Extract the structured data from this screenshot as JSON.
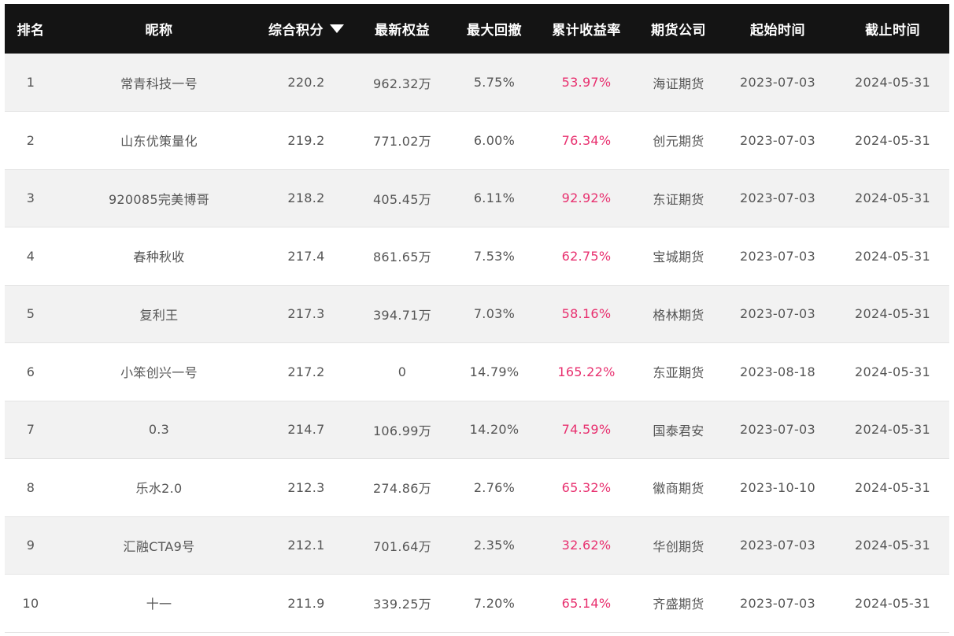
{
  "headers": {
    "rank": "排名",
    "nickname": "昵称",
    "score": "综合积分",
    "equity": "最新权益",
    "drawdown": "最大回撤",
    "return": "累计收益率",
    "company": "期货公司",
    "start": "起始时间",
    "end": "截止时间"
  },
  "icons": {
    "sort": "sort-desc-icon"
  },
  "colors": {
    "header_bg": "#141414",
    "row_odd": "#f2f2f2",
    "row_even": "#ffffff",
    "return_text": "#e8306f"
  },
  "rows": [
    {
      "rank": "1",
      "nickname": "常青科技一号",
      "score": "220.2",
      "equity": "962.32万",
      "drawdown": "5.75%",
      "return": "53.97%",
      "company": "海证期货",
      "start": "2023-07-03",
      "end": "2024-05-31"
    },
    {
      "rank": "2",
      "nickname": "山东优策量化",
      "score": "219.2",
      "equity": "771.02万",
      "drawdown": "6.00%",
      "return": "76.34%",
      "company": "创元期货",
      "start": "2023-07-03",
      "end": "2024-05-31"
    },
    {
      "rank": "3",
      "nickname": "920085完美博哥",
      "score": "218.2",
      "equity": "405.45万",
      "drawdown": "6.11%",
      "return": "92.92%",
      "company": "东证期货",
      "start": "2023-07-03",
      "end": "2024-05-31"
    },
    {
      "rank": "4",
      "nickname": "春种秋收",
      "score": "217.4",
      "equity": "861.65万",
      "drawdown": "7.53%",
      "return": "62.75%",
      "company": "宝城期货",
      "start": "2023-07-03",
      "end": "2024-05-31"
    },
    {
      "rank": "5",
      "nickname": "复利王",
      "score": "217.3",
      "equity": "394.71万",
      "drawdown": "7.03%",
      "return": "58.16%",
      "company": "格林期货",
      "start": "2023-07-03",
      "end": "2024-05-31"
    },
    {
      "rank": "6",
      "nickname": "小笨创兴一号",
      "score": "217.2",
      "equity": "0",
      "drawdown": "14.79%",
      "return": "165.22%",
      "company": "东亚期货",
      "start": "2023-08-18",
      "end": "2024-05-31"
    },
    {
      "rank": "7",
      "nickname": "0.3",
      "score": "214.7",
      "equity": "106.99万",
      "drawdown": "14.20%",
      "return": "74.59%",
      "company": "国泰君安",
      "start": "2023-07-03",
      "end": "2024-05-31"
    },
    {
      "rank": "8",
      "nickname": "乐水2.0",
      "score": "212.3",
      "equity": "274.86万",
      "drawdown": "2.76%",
      "return": "65.32%",
      "company": "徽商期货",
      "start": "2023-10-10",
      "end": "2024-05-31"
    },
    {
      "rank": "9",
      "nickname": "汇融CTA9号",
      "score": "212.1",
      "equity": "701.64万",
      "drawdown": "2.35%",
      "return": "32.62%",
      "company": "华创期货",
      "start": "2023-07-03",
      "end": "2024-05-31"
    },
    {
      "rank": "10",
      "nickname": "十一",
      "score": "211.9",
      "equity": "339.25万",
      "drawdown": "7.20%",
      "return": "65.14%",
      "company": "齐盛期货",
      "start": "2023-07-03",
      "end": "2024-05-31"
    }
  ]
}
